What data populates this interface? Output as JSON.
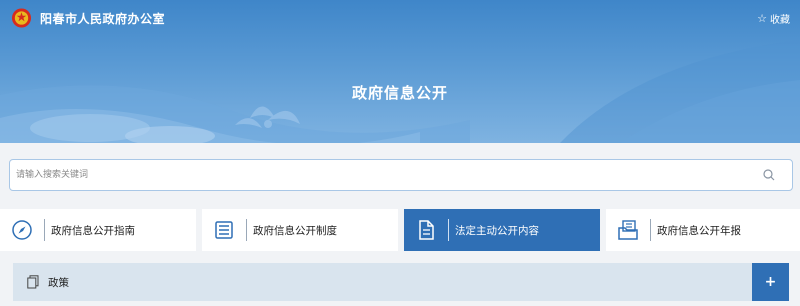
{
  "header": {
    "site_name": "阳春市人民政府办公室",
    "favorite_label": "收藏",
    "banner_title": "政府信息公开"
  },
  "search": {
    "placeholder": "请输入搜索关键词",
    "icon": "search-icon"
  },
  "categories": [
    {
      "label": "政府信息公开指南",
      "icon": "compass-icon",
      "active": false
    },
    {
      "label": "政府信息公开制度",
      "icon": "document-list-icon",
      "active": false
    },
    {
      "label": "法定主动公开内容",
      "icon": "file-icon",
      "active": true
    },
    {
      "label": "政府信息公开年报",
      "icon": "folder-report-icon",
      "active": false
    }
  ],
  "policy": {
    "label": "政策",
    "expand_label": "+"
  },
  "colors": {
    "banner_top": "#3f86c9",
    "accent": "#2f6fb5",
    "page_bg": "#f1f3f6",
    "policy_bg": "#d9e4ee"
  }
}
